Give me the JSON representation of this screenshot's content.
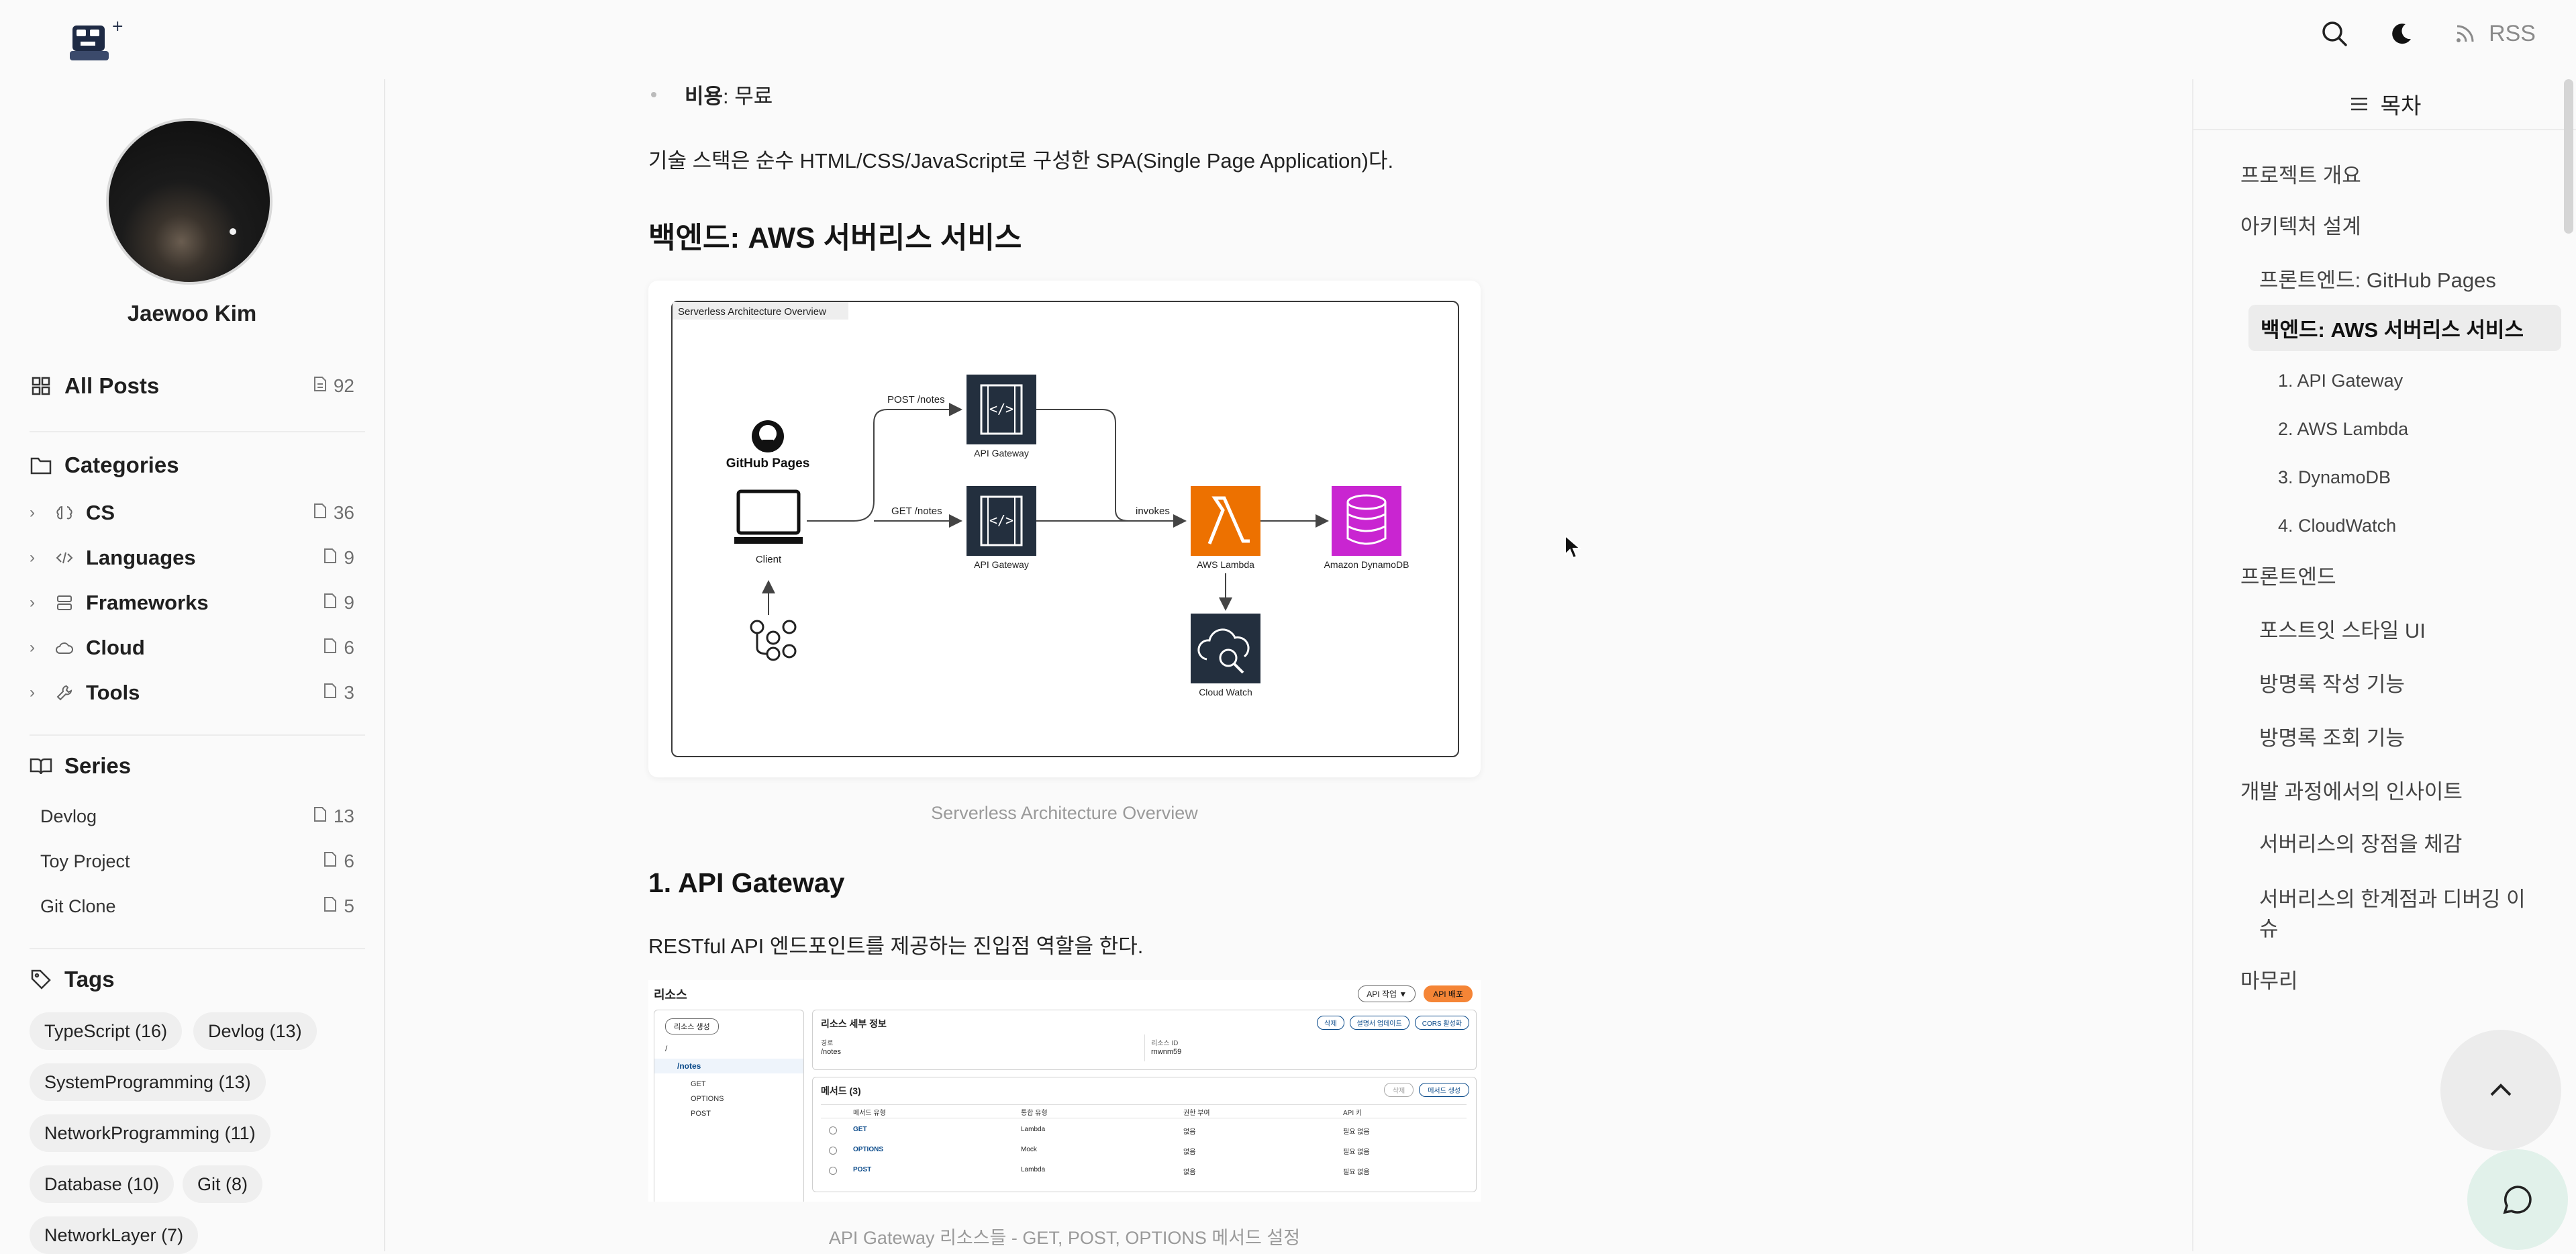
{
  "header": {
    "logo_alt": "blog-logo",
    "rss_label": "RSS"
  },
  "profile": {
    "name": "Jaewoo Kim"
  },
  "nav": {
    "all_posts_label": "All Posts",
    "all_posts_count": "92",
    "categories_title": "Categories",
    "categories": [
      {
        "label": "CS",
        "count": "36"
      },
      {
        "label": "Languages",
        "count": "9"
      },
      {
        "label": "Frameworks",
        "count": "9"
      },
      {
        "label": "Cloud",
        "count": "6"
      },
      {
        "label": "Tools",
        "count": "3"
      }
    ],
    "series_title": "Series",
    "series": [
      {
        "label": "Devlog",
        "count": "13"
      },
      {
        "label": "Toy Project",
        "count": "6"
      },
      {
        "label": "Git Clone",
        "count": "5"
      }
    ],
    "tags_title": "Tags",
    "tags": [
      "TypeScript (16)",
      "Devlog (13)",
      "SystemProgramming (13)",
      "NetworkProgramming (11)",
      "Database (10)",
      "Git (8)",
      "NetworkLayer (7)"
    ]
  },
  "article": {
    "cost_label": "비용",
    "cost_value": ": 무료",
    "stack_text": "기술 스택은 순수 HTML/CSS/JavaScript로 구성한 SPA(Single Page Application)다.",
    "backend_heading": "백엔드: AWS 서버리스 서비스",
    "fig1_caption": "Serverless Architecture Overview",
    "diagram": {
      "frame_title": "Serverless Architecture Overview",
      "github_pages": "GitHub Pages",
      "client": "Client",
      "post_route": "POST /notes",
      "get_route": "GET /notes",
      "api_gateway_1": "API Gateway",
      "api_gateway_2": "API Gateway",
      "invokes": "invokes",
      "lambda": "AWS Lambda",
      "dynamo": "Amazon DynamoDB",
      "cloudwatch": "Cloud Watch"
    },
    "apigw_heading": "1. API Gateway",
    "apigw_text": "RESTful API 엔드포인트를 제공하는 진입점 역할을 한다.",
    "fig2_caption": "API Gateway 리소스들 - GET, POST, OPTIONS 메서드 설정",
    "console": {
      "resources_title": "리소스",
      "create_resource": "리소스 생성",
      "api_actions": "API 작업 ▼",
      "deploy_api": "API 배포",
      "tree_root": "/",
      "tree_notes": "/notes",
      "tree_methods": [
        "GET",
        "OPTIONS",
        "POST"
      ],
      "detail_title": "리소스 세부 정보",
      "btn_delete": "삭제",
      "btn_update": "설명서 업데이트",
      "btn_cors": "CORS 활성화",
      "path_label": "경로",
      "path_value": "/notes",
      "id_label": "리소스 ID",
      "id_value": "rnwnm59",
      "methods_title": "메서드 (3)",
      "btn_remove": "삭제",
      "btn_create_method": "메서드 생성",
      "columns": [
        "메서드 유형",
        "통합 유형",
        "권한 부여",
        "API 키"
      ],
      "rows": [
        [
          "GET",
          "Lambda",
          "없음",
          "필요 없음"
        ],
        [
          "OPTIONS",
          "Mock",
          "없음",
          "필요 없음"
        ],
        [
          "POST",
          "Lambda",
          "없음",
          "필요 없음"
        ]
      ]
    }
  },
  "toc": {
    "title": "목차",
    "items": [
      {
        "label": "프로젝트 개요",
        "level": 1
      },
      {
        "label": "아키텍처 설계",
        "level": 1
      },
      {
        "label": "프론트엔드: GitHub Pages",
        "level": 2
      },
      {
        "label": "백엔드: AWS 서버리스 서비스",
        "level": 2,
        "active": true
      },
      {
        "label": "1. API Gateway",
        "level": 3
      },
      {
        "label": "2. AWS Lambda",
        "level": 3
      },
      {
        "label": "3. DynamoDB",
        "level": 3
      },
      {
        "label": "4. CloudWatch",
        "level": 3
      },
      {
        "label": "프론트엔드",
        "level": 1
      },
      {
        "label": "포스트잇 스타일 UI",
        "level": 2
      },
      {
        "label": "방명록 작성 기능",
        "level": 2
      },
      {
        "label": "방명록 조회 기능",
        "level": 2
      },
      {
        "label": "개발 과정에서의 인사이트",
        "level": 1
      },
      {
        "label": "서버리스의 장점을 체감",
        "level": 2
      },
      {
        "label": "서버리스의 한계점과 디버깅 이",
        "level": 2
      },
      {
        "label": "슈",
        "level": 2
      },
      {
        "label": "마무리",
        "level": 1
      }
    ]
  },
  "colors": {
    "lambda_orange": "#ED7100",
    "dynamo_magenta": "#C925D1",
    "aws_dark": "#232F3E",
    "deploy_orange": "#F58536"
  }
}
